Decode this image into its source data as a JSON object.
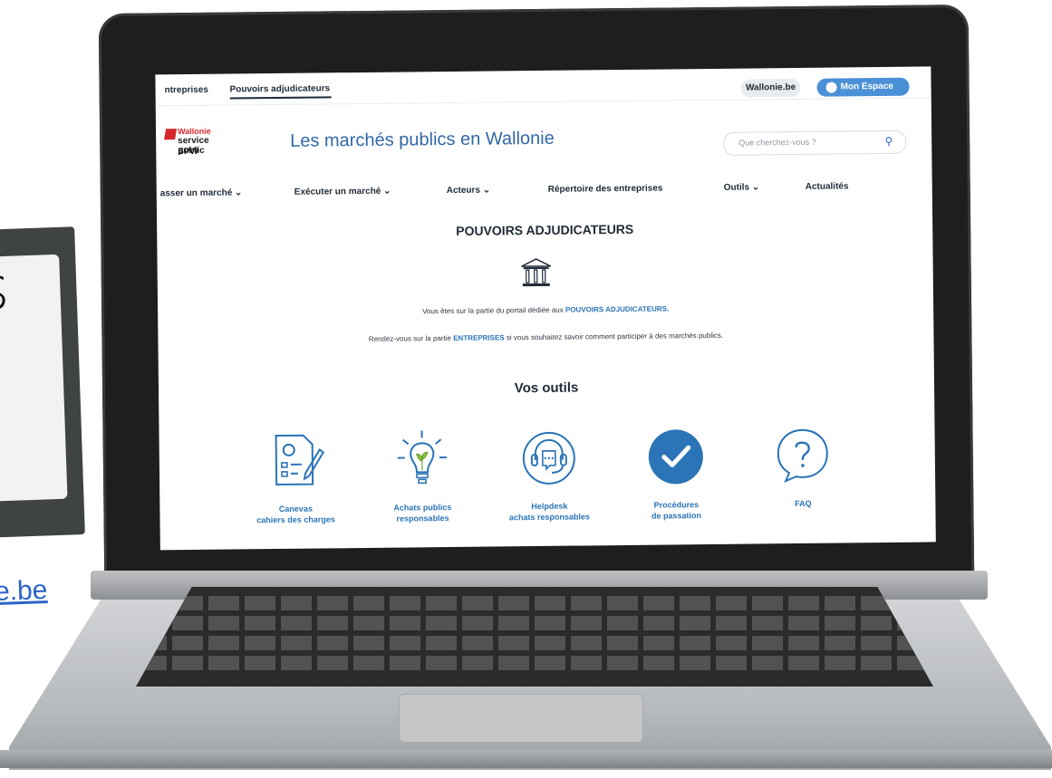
{
  "left": {
    "letter": "s",
    "link_fragment": "e.be"
  },
  "topbar": {
    "tabs": [
      "ntreprises",
      "Pouvoirs adjudicateurs"
    ],
    "wallonie_pill": "Wallonie.be",
    "mon_espace": "Mon Espace"
  },
  "header": {
    "logo": [
      "Wallonie",
      "service public",
      "SPW"
    ],
    "site_title": "Les marchés publics en Wallonie",
    "search_placeholder": "Que cherchez-vous ?"
  },
  "nav": {
    "items": [
      "asser un marché ⌄",
      "Exécuter un marché ⌄",
      "Acteurs ⌄",
      "Répertoire des entreprises",
      "Outils ⌄",
      "Actualités"
    ]
  },
  "main": {
    "section_title": "POUVOIRS ADJUDICATEURS",
    "line1_prefix": "Vous êtes sur la partie du portail dédiée aux ",
    "line1_highlight": "POUVOIRS ADJUDICATEURS.",
    "line2_prefix": "Rendez-vous sur la partie ",
    "line2_highlight": "ENTREPRISES",
    "line2_suffix": " si vous souhaitez savoir comment participer à des marchés publics.",
    "tools_title": "Vos outils"
  },
  "tools": [
    {
      "label1": "Canevas",
      "label2": "cahiers des charges",
      "icon": "document-gear-icon"
    },
    {
      "label1": "Achats publics",
      "label2": "responsables",
      "icon": "lightbulb-leaf-icon"
    },
    {
      "label1": "Helpdesk",
      "label2": "achats responsables",
      "icon": "headset-icon"
    },
    {
      "label1": "Procédures",
      "label2": "de passation",
      "icon": "check-circle-icon"
    },
    {
      "label1": "FAQ",
      "label2": "",
      "icon": "question-bubble-icon"
    }
  ],
  "colors": {
    "accent_blue": "#2a74b7",
    "title_blue": "#3267a8",
    "espace_blue": "#4a90d6",
    "brand_red": "#d7262e"
  }
}
